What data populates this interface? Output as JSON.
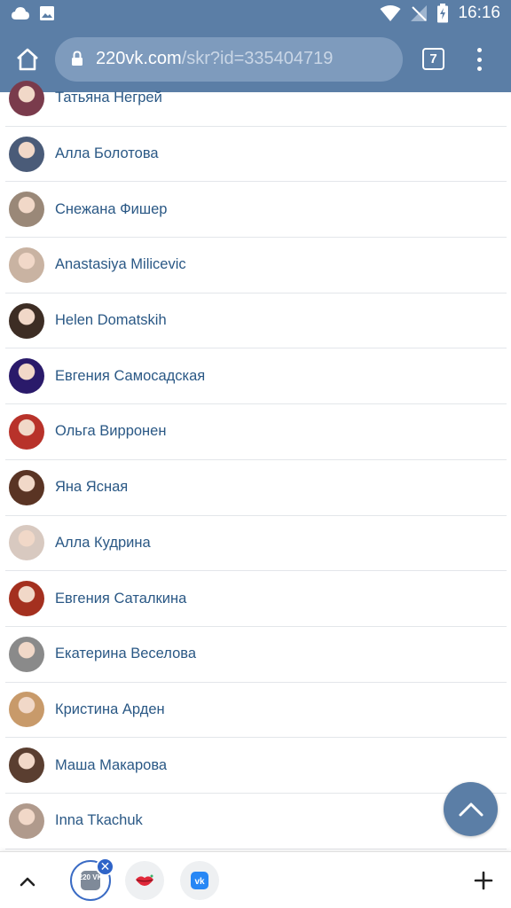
{
  "status_bar": {
    "time": "16:16",
    "left_icons": [
      "cloud-icon",
      "image-icon"
    ],
    "right_icons": [
      "wifi-icon",
      "signal-icon",
      "battery-icon"
    ]
  },
  "browser": {
    "url_host": "220vk.com",
    "url_path": "/skr?id=335404719",
    "tab_count": "7",
    "accent_color": "#5b7ea6"
  },
  "list": {
    "items": [
      {
        "name": "Татьяна Негрей",
        "avatar_color": "#7a3b4c"
      },
      {
        "name": "Алла Болотова",
        "avatar_color": "#4a5b78"
      },
      {
        "name": "Снежана Фишер",
        "avatar_color": "#9a8878"
      },
      {
        "name": "Anastasiya Milicevic",
        "avatar_color": "#c9b3a2"
      },
      {
        "name": "Helen Domatskih",
        "avatar_color": "#3d2d24"
      },
      {
        "name": "Евгения Самосадская",
        "avatar_color": "#2a1a6a"
      },
      {
        "name": "Ольга Вирронен",
        "avatar_color": "#b8322a"
      },
      {
        "name": "Яна Ясная",
        "avatar_color": "#5a3424"
      },
      {
        "name": "Алла Кудрина",
        "avatar_color": "#d8c9c0"
      },
      {
        "name": "Евгения Саталкина",
        "avatar_color": "#a4301f"
      },
      {
        "name": "Екатерина Веселова",
        "avatar_color": "#8a8a8a"
      },
      {
        "name": "Кристина Арден",
        "avatar_color": "#c89a6a"
      },
      {
        "name": "Маша Макарова",
        "avatar_color": "#5a3e30"
      },
      {
        "name": "Inna Tkachuk",
        "avatar_color": "#b09a8c"
      }
    ]
  },
  "bottom_bar": {
    "apps": [
      {
        "icon": "220vk-app-icon",
        "label": "220 VK"
      },
      {
        "icon": "lips-app-icon"
      },
      {
        "icon": "vk-app-icon",
        "label": "vk"
      }
    ],
    "close_symbol": "✕"
  }
}
